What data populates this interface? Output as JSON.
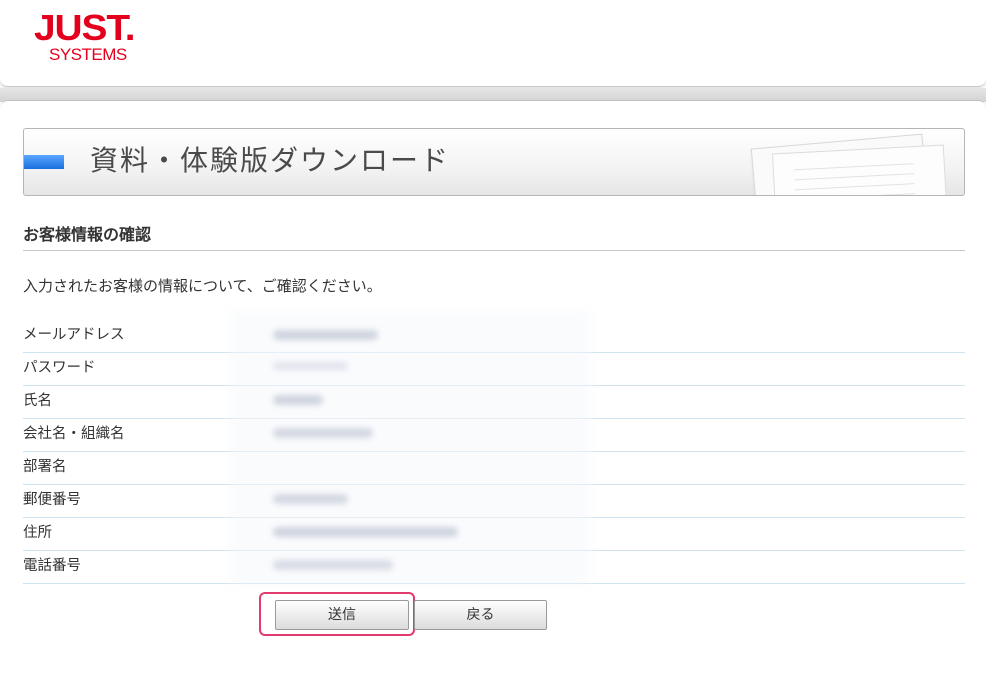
{
  "logo": {
    "brand": "JUST.",
    "sub": "SYSTEMS"
  },
  "banner": {
    "title": "資料・体験版ダウンロード"
  },
  "section": {
    "title": "お客様情報の確認",
    "intro": "入力されたお客様の情報について、ご確認ください。"
  },
  "fields": [
    {
      "label": "メールアドレス"
    },
    {
      "label": "パスワード"
    },
    {
      "label": "氏名"
    },
    {
      "label": "会社名・組織名"
    },
    {
      "label": "部署名"
    },
    {
      "label": "郵便番号"
    },
    {
      "label": "住所"
    },
    {
      "label": "電話番号"
    }
  ],
  "buttons": {
    "send": "送信",
    "back": "戻る"
  },
  "colors": {
    "brand_red": "#e4001c",
    "highlight": "#e33a6e",
    "accent_blue": "#1b6fe0"
  }
}
